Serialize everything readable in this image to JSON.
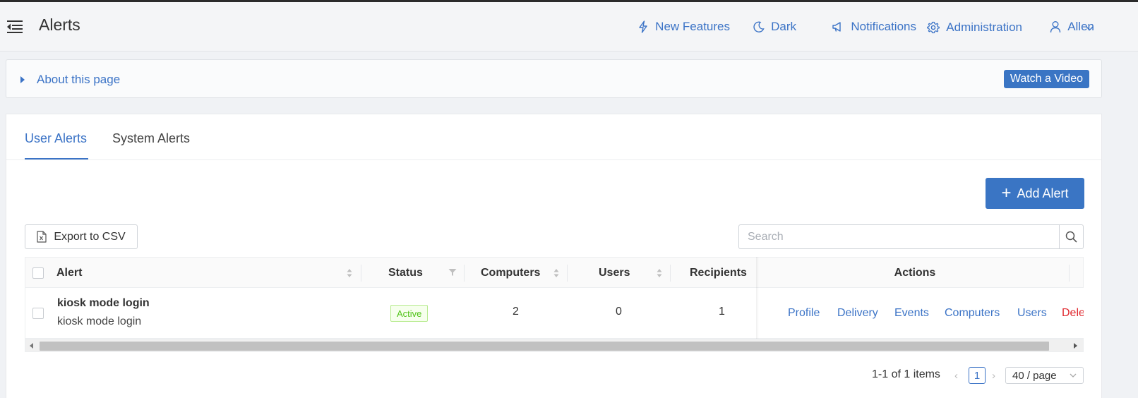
{
  "header": {
    "title": "Alerts",
    "nav": {
      "new_features": "New Features",
      "dark": "Dark",
      "notifications": "Notifications",
      "administration": "Administration",
      "user": "Allen"
    }
  },
  "about": {
    "label": "About this page",
    "watch_video": "Watch a Video"
  },
  "tabs": [
    {
      "label": "User Alerts",
      "active": true
    },
    {
      "label": "System Alerts",
      "active": false
    }
  ],
  "toolbar": {
    "add_alert": "Add Alert",
    "export_csv": "Export to CSV",
    "search_placeholder": "Search"
  },
  "table": {
    "columns": {
      "alert": "Alert",
      "status": "Status",
      "computers": "Computers",
      "users": "Users",
      "recipients": "Recipients",
      "actions": "Actions"
    },
    "rows": [
      {
        "name": "kiosk mode login",
        "description": "kiosk mode login",
        "status": "Active",
        "computers": "2",
        "users": "0",
        "recipients": "1",
        "actions": [
          "Profile",
          "Delivery",
          "Events",
          "Computers",
          "Users",
          "Dele"
        ]
      }
    ]
  },
  "pagination": {
    "total": "1-1 of 1 items",
    "current": "1",
    "page_size": "40 / page"
  },
  "colors": {
    "accent": "#3b73c6",
    "button": "#3a75c4",
    "active_green": "#52c41a",
    "danger": "#e0282e"
  }
}
